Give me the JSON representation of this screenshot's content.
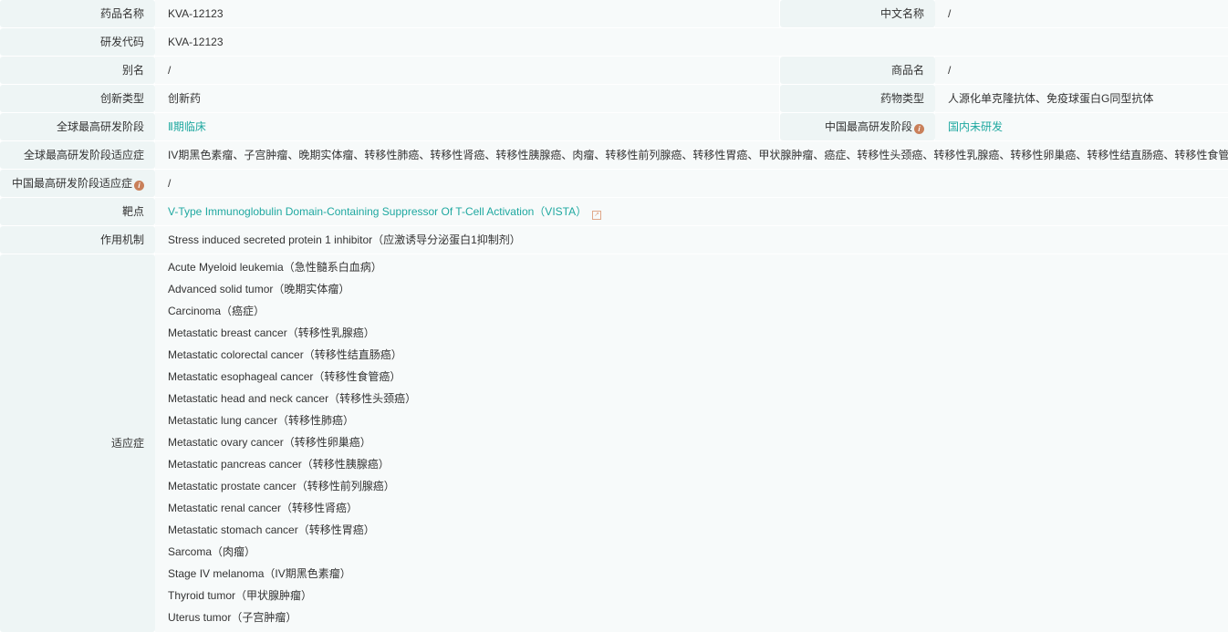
{
  "fields": {
    "drug_name": {
      "label": "药品名称",
      "value": "KVA-12123"
    },
    "chinese_name": {
      "label": "中文名称",
      "value": "/"
    },
    "dev_code": {
      "label": "研发代码",
      "value": "KVA-12123"
    },
    "alias": {
      "label": "别名",
      "value": "/"
    },
    "trade_name": {
      "label": "商品名",
      "value": "/"
    },
    "innovation_type": {
      "label": "创新类型",
      "value": "创新药"
    },
    "drug_type": {
      "label": "药物类型",
      "value": "人源化单克隆抗体、免疫球蛋白G同型抗体"
    },
    "global_stage": {
      "label": "全球最高研发阶段",
      "value": "Ⅱ期临床"
    },
    "china_stage": {
      "label": "中国最高研发阶段",
      "value": "国内未研发"
    },
    "global_stage_indication": {
      "label": "全球最高研发阶段适应症",
      "value": "IV期黑色素瘤、子宫肿瘤、晚期实体瘤、转移性肺癌、转移性肾癌、转移性胰腺癌、肉瘤、转移性前列腺癌、转移性胃癌、甲状腺肿瘤、癌症、转移性头颈癌、转移性乳腺癌、转移性卵巢癌、转移性结直肠癌、转移性食管癌"
    },
    "china_stage_indication": {
      "label": "中国最高研发阶段适应症",
      "value": "/"
    },
    "target": {
      "label": "靶点",
      "value": "V-Type Immunoglobulin Domain-Containing Suppressor Of T-Cell Activation（VISTA）"
    },
    "mechanism": {
      "label": "作用机制",
      "value": "Stress induced secreted protein 1 inhibitor（应激诱导分泌蛋白1抑制剂）"
    },
    "indications": {
      "label": "适应症",
      "items": [
        "Acute Myeloid leukemia（急性髓系白血病）",
        "Advanced solid tumor（晚期实体瘤）",
        "Carcinoma（癌症）",
        "Metastatic breast cancer（转移性乳腺癌）",
        "Metastatic colorectal cancer（转移性结直肠癌）",
        "Metastatic esophageal cancer（转移性食管癌）",
        "Metastatic head and neck cancer（转移性头颈癌）",
        "Metastatic lung cancer（转移性肺癌）",
        "Metastatic ovary cancer（转移性卵巢癌）",
        "Metastatic pancreas cancer（转移性胰腺癌）",
        "Metastatic prostate cancer（转移性前列腺癌）",
        "Metastatic renal cancer（转移性肾癌）",
        "Metastatic stomach cancer（转移性胃癌）",
        "Sarcoma（肉瘤）",
        "Stage IV melanoma（IV期黑色素瘤）",
        "Thyroid tumor（甲状腺肿瘤）",
        "Uterus tumor（子宫肿瘤）"
      ]
    }
  },
  "colors": {
    "link": "#1fa8a0",
    "info": "#c9805a"
  }
}
